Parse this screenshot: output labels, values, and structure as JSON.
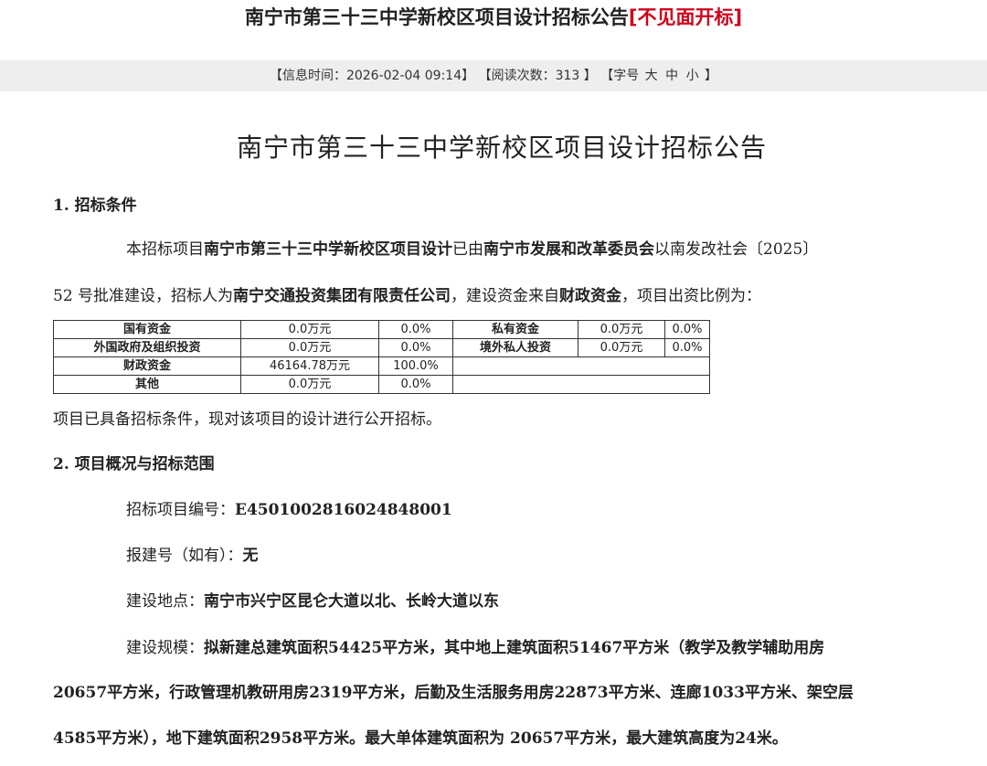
{
  "header": {
    "title": "南宁市第三十三中学新校区项目设计招标公告",
    "tag": "[不见面开标]"
  },
  "meta": {
    "info_time_label": "【信息时间：",
    "info_time": "2026-02-04 09:14",
    "read_label": "】 【阅读次数：",
    "read_count": "313",
    "size_label": " 】 【字号",
    "size_large": "大",
    "size_medium": "中",
    "size_small": "小",
    "size_end": "】"
  },
  "article": {
    "title": "南宁市第三十三中学新校区项目设计招标公告",
    "sec1": {
      "heading": "1. 招标条件",
      "p1_a": "本招标项目",
      "p1_b": "南宁市第三十三中学新校区项目设计",
      "p1_c": "已由",
      "p1_d": "南宁市发展和改革委员会",
      "p1_e": "以南发改社会〔2025〕",
      "p2_a": "52 号批准建设，招标人为",
      "p2_b": "南宁交通投资集团有限责任公司",
      "p2_c": "，建设资金来自",
      "p2_d": "财政资金",
      "p2_e": "，项目出资比例为：",
      "funding": {
        "rows": [
          [
            "国有资金",
            "0.0万元",
            "0.0%",
            "私有资金",
            "0.0万元",
            "0.0%"
          ],
          [
            "外国政府及组织投资",
            "0.0万元",
            "0.0%",
            "境外私人投资",
            "0.0万元",
            "0.0%"
          ],
          [
            "财政资金",
            "46164.78万元",
            "100.0%",
            "",
            "",
            ""
          ],
          [
            "其他",
            "0.0万元",
            "0.0%",
            "",
            "",
            ""
          ]
        ]
      },
      "p3": "项目已具备招标条件，现对该项目的设计进行公开招标。"
    },
    "sec2": {
      "heading": "2. 项目概况与招标范围",
      "code_label": "招标项目编号：",
      "code_value": "E4501002816024848001",
      "permit_label": "报建号（如有）：",
      "permit_value": "无",
      "location_label": "建设地点：",
      "location_value": "南宁市兴宁区昆仑大道以北、长岭大道以东",
      "scale_label": "建设规模：",
      "scale_line1": "拟新建总建筑面积54425平方米，其中地上建筑面积51467平方米（教学及教学辅助用房",
      "scale_line2": "20657平方米，行政管理机教研用房2319平方米，后勤及生活服务用房22873平方米、连廊1033平方米、架空层",
      "scale_line3": "4585平方米），地下建筑面积2958平方米。最大单体建筑面积为 20657平方米，最大建筑高度为24米。"
    }
  }
}
